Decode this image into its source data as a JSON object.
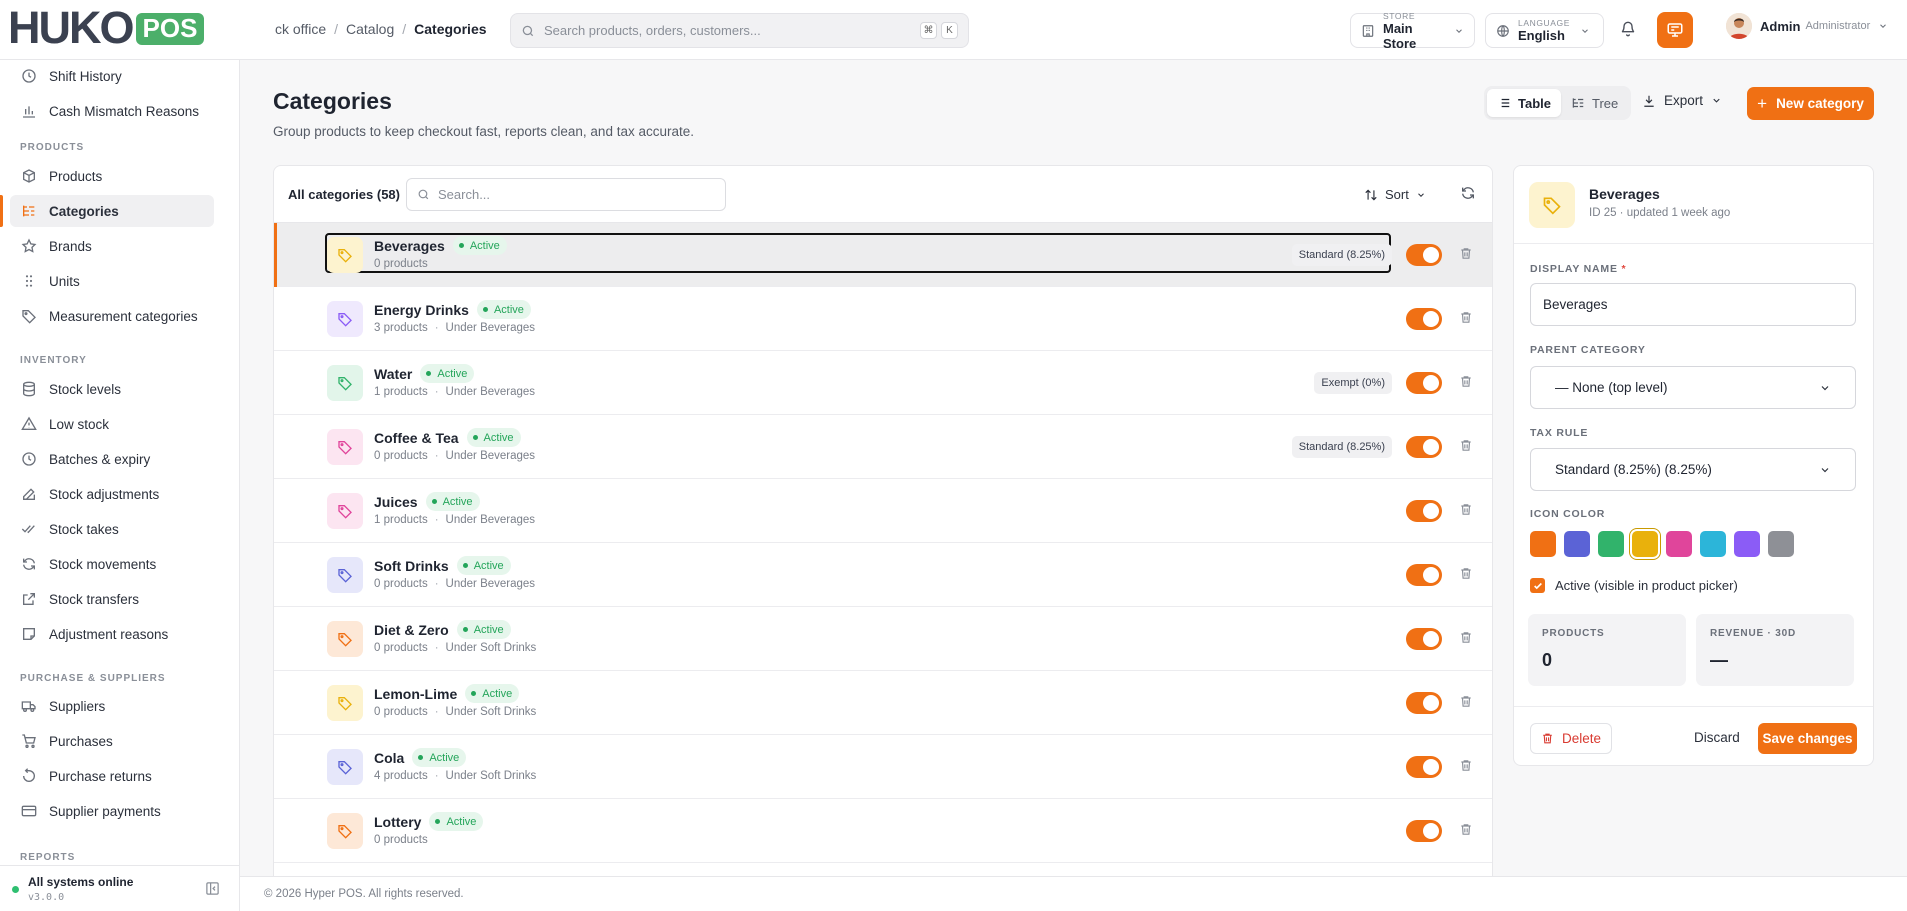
{
  "app": {
    "logo_word": "HUKO",
    "logo_badge": "POS"
  },
  "breadcrumb": [
    "ck office",
    "Catalog",
    "Categories"
  ],
  "search": {
    "placeholder": "Search products, orders, customers...",
    "kbd1": "⌘",
    "kbd2": "K"
  },
  "store": {
    "label": "STORE",
    "value": "Main Store"
  },
  "language": {
    "label": "LANGUAGE",
    "value": "English"
  },
  "user": {
    "name": "Admin",
    "role": "Administrator"
  },
  "sidebar": {
    "top_items": [
      {
        "label": "Shift History",
        "icon": "clock-icon"
      },
      {
        "label": "Cash Mismatch Reasons",
        "icon": "bar-chart-icon"
      }
    ],
    "sections": [
      {
        "title": "PRODUCTS",
        "items": [
          {
            "label": "Products",
            "icon": "box-icon"
          },
          {
            "label": "Categories",
            "icon": "list-tree-icon",
            "active": true
          },
          {
            "label": "Brands",
            "icon": "star-icon"
          },
          {
            "label": "Units",
            "icon": "grip-icon"
          },
          {
            "label": "Measurement categories",
            "icon": "tag-icon"
          }
        ]
      },
      {
        "title": "INVENTORY",
        "items": [
          {
            "label": "Stock levels",
            "icon": "database-icon"
          },
          {
            "label": "Low stock",
            "icon": "warning-icon"
          },
          {
            "label": "Batches & expiry",
            "icon": "clock-icon"
          },
          {
            "label": "Stock adjustments",
            "icon": "edit-icon"
          },
          {
            "label": "Stock takes",
            "icon": "check-check-icon"
          },
          {
            "label": "Stock movements",
            "icon": "refresh-icon"
          },
          {
            "label": "Stock transfers",
            "icon": "external-icon"
          },
          {
            "label": "Adjustment reasons",
            "icon": "note-icon"
          }
        ]
      },
      {
        "title": "PURCHASE & SUPPLIERS",
        "items": [
          {
            "label": "Suppliers",
            "icon": "truck-icon"
          },
          {
            "label": "Purchases",
            "icon": "cart-icon"
          },
          {
            "label": "Purchase returns",
            "icon": "undo-icon"
          },
          {
            "label": "Supplier payments",
            "icon": "card-icon"
          }
        ]
      },
      {
        "title": "REPORTS",
        "items": []
      }
    ],
    "system": {
      "status": "All systems online",
      "version": "v3.0.0"
    }
  },
  "page": {
    "title": "Categories",
    "subtitle": "Group products to keep checkout fast, reports clean, and tax accurate.",
    "view_table": "Table",
    "view_tree": "Tree",
    "export": "Export",
    "new_button": "New category"
  },
  "list": {
    "count_label": "All categories (58)",
    "search_placeholder": "Search...",
    "sort_label": "Sort",
    "rows": [
      {
        "name": "Beverages",
        "status": "Active",
        "products": "0 products",
        "parent": "",
        "tax": "Standard (8.25%)",
        "color": "#e9b10c",
        "bg": "#fdf3cf",
        "selected": true
      },
      {
        "name": "Energy Drinks",
        "status": "Active",
        "products": "3 products",
        "parent": "Under Beverages",
        "tax": "",
        "color": "#8b5cf6",
        "bg": "#efe9fd"
      },
      {
        "name": "Water",
        "status": "Active",
        "products": "1 products",
        "parent": "Under Beverages",
        "tax": "Exempt (0%)",
        "color": "#31b36b",
        "bg": "#e2f5ea"
      },
      {
        "name": "Coffee & Tea",
        "status": "Active",
        "products": "0 products",
        "parent": "Under Beverages",
        "tax": "Standard (8.25%)",
        "color": "#e0459b",
        "bg": "#fce5f1"
      },
      {
        "name": "Juices",
        "status": "Active",
        "products": "1 products",
        "parent": "Under Beverages",
        "tax": "",
        "color": "#e0459b",
        "bg": "#fce5f1"
      },
      {
        "name": "Soft Drinks",
        "status": "Active",
        "products": "0 products",
        "parent": "Under Beverages",
        "tax": "",
        "color": "#5b63d6",
        "bg": "#e6e7fa"
      },
      {
        "name": "Diet & Zero",
        "status": "Active",
        "products": "0 products",
        "parent": "Under Soft Drinks",
        "tax": "",
        "color": "#f07014",
        "bg": "#fde8d7"
      },
      {
        "name": "Lemon-Lime",
        "status": "Active",
        "products": "0 products",
        "parent": "Under Soft Drinks",
        "tax": "",
        "color": "#e9b10c",
        "bg": "#fdf3cf"
      },
      {
        "name": "Cola",
        "status": "Active",
        "products": "4 products",
        "parent": "Under Soft Drinks",
        "tax": "",
        "color": "#5b63d6",
        "bg": "#e6e7fa"
      },
      {
        "name": "Lottery",
        "status": "Active",
        "products": "0 products",
        "parent": "",
        "tax": "",
        "color": "#f07014",
        "bg": "#fde8d7"
      }
    ]
  },
  "detail": {
    "title": "Beverages",
    "subtitle": "ID 25 · updated 1 week ago",
    "display_name_label": "DISPLAY NAME",
    "display_name_value": "Beverages",
    "parent_label": "PARENT CATEGORY",
    "parent_value": "— None (top level)",
    "tax_label": "TAX RULE",
    "tax_value": "Standard (8.25%) (8.25%)",
    "icon_color_label": "ICON COLOR",
    "colors": [
      "#f07014",
      "#5b63d6",
      "#31b36b",
      "#e9b10c",
      "#e0459b",
      "#2cb5d9",
      "#8b5cf6",
      "#8e9096"
    ],
    "selected_color": "#e9b10c",
    "active_label": "Active (visible in product picker)",
    "products_label": "PRODUCTS",
    "products_value": "0",
    "revenue_label": "REVENUE · 30D",
    "revenue_value": "—",
    "delete_label": "Delete",
    "discard_label": "Discard",
    "save_label": "Save changes"
  },
  "footer": {
    "text": "© 2026 Hyper POS. All rights reserved."
  },
  "accent": "#f07014"
}
